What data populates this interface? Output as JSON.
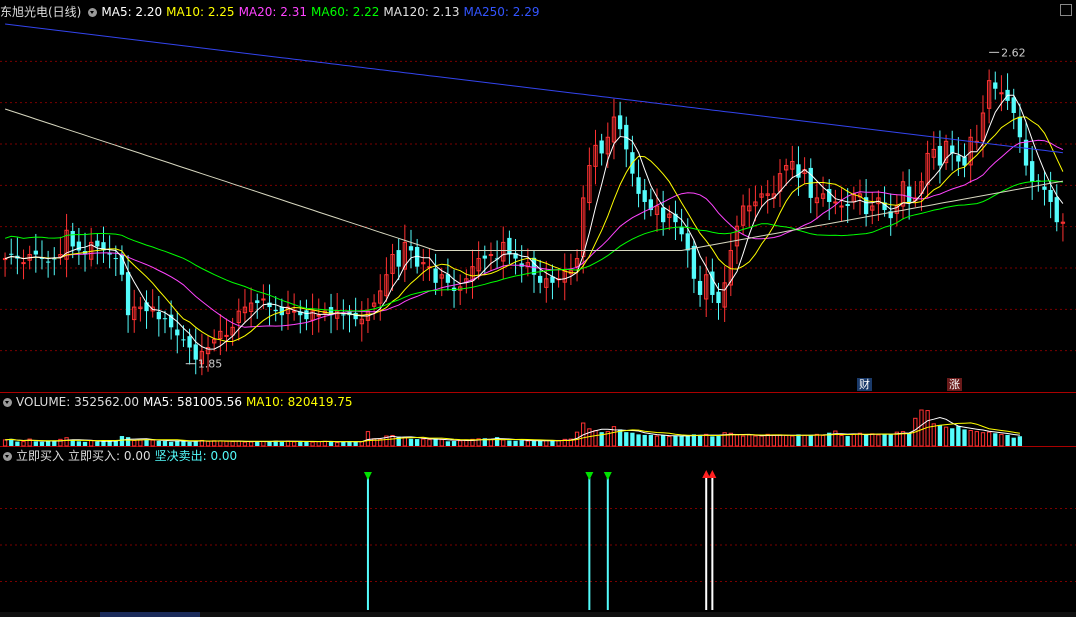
{
  "header": {
    "title": "东旭光电(日线)",
    "ma": [
      {
        "label": "MA5: 2.20",
        "color": "#ffffff"
      },
      {
        "label": "MA10: 2.25",
        "color": "#ffff00"
      },
      {
        "label": "MA20: 2.31",
        "color": "#ff44ff"
      },
      {
        "label": "MA60: 2.22",
        "color": "#00ff00"
      },
      {
        "label": "MA120: 2.13",
        "color": "#e0e0e0"
      },
      {
        "label": "MA250: 2.29",
        "color": "#3355ff"
      }
    ]
  },
  "volume_header": {
    "label": "VOLUME: 352562.00",
    "ma5": "MA5: 581005.56",
    "ma10": "MA10: 820419.75"
  },
  "signal_header": {
    "name": "立即买入",
    "buy": "立即买入: 0.00",
    "sell": "坚决卖出: 0.00"
  },
  "badges": {
    "cai": "财",
    "zhang": "涨"
  },
  "annotations": {
    "high": "2.62",
    "low": "1.85"
  },
  "colors": {
    "up": "#ff3232",
    "down": "#54fcfc",
    "grid": "#7a0000",
    "ma5": "#ffffff",
    "ma10": "#ffff00",
    "ma20": "#ff44ff",
    "ma60": "#00ff00",
    "ma120": "#d8d8c0",
    "ma250": "#3344ee"
  },
  "chart_data": {
    "type": "candlestick",
    "symbol": "东旭光电",
    "period": "日线",
    "price_range": [
      1.78,
      2.7
    ],
    "high_mark": 2.62,
    "low_mark": 1.85,
    "closes": [
      2.11,
      2.12,
      2.11,
      2.1,
      2.12,
      2.12,
      2.11,
      2.1,
      2.11,
      2.12,
      2.18,
      2.14,
      2.13,
      2.12,
      2.15,
      2.14,
      2.13,
      2.12,
      2.11,
      2.07,
      1.97,
      1.99,
      1.99,
      1.98,
      1.99,
      1.96,
      1.96,
      1.94,
      1.92,
      1.91,
      1.89,
      1.86,
      1.88,
      1.89,
      1.91,
      1.93,
      1.92,
      1.94,
      1.98,
      1.99,
      2.0,
      2.0,
      2.01,
      1.99,
      1.98,
      1.97,
      1.99,
      1.98,
      1.97,
      1.96,
      1.98,
      1.97,
      1.98,
      1.97,
      1.98,
      1.97,
      1.97,
      1.96,
      1.96,
      1.98,
      2.0,
      2.03,
      2.07,
      2.12,
      2.09,
      2.15,
      2.13,
      2.09,
      2.1,
      2.09,
      2.05,
      2.07,
      2.05,
      2.03,
      2.04,
      2.06,
      2.09,
      2.11,
      2.11,
      2.12,
      2.11,
      2.15,
      2.12,
      2.11,
      2.09,
      2.1,
      2.07,
      2.05,
      2.06,
      2.05,
      2.06,
      2.08,
      2.08,
      2.11,
      2.26,
      2.34,
      2.39,
      2.37,
      2.41,
      2.46,
      2.43,
      2.38,
      2.32,
      2.27,
      2.25,
      2.23,
      2.24,
      2.2,
      2.22,
      2.2,
      2.17,
      2.13,
      2.06,
      2.02,
      2.07,
      2.02,
      2.0,
      2.05,
      2.13,
      2.19,
      2.24,
      2.24,
      2.25,
      2.27,
      2.27,
      2.27,
      2.32,
      2.34,
      2.35,
      2.31,
      2.33,
      2.26,
      2.26,
      2.27,
      2.25,
      2.25,
      2.24,
      2.24,
      2.27,
      2.27,
      2.22,
      2.24,
      2.26,
      2.23,
      2.21,
      2.24,
      2.3,
      2.25,
      2.26,
      2.3,
      2.37,
      2.38,
      2.34,
      2.4,
      2.37,
      2.35,
      2.34,
      2.41,
      2.4,
      2.47,
      2.55,
      2.53,
      2.52,
      2.5,
      2.47,
      2.41,
      2.34,
      2.3,
      2.3,
      2.28,
      2.25,
      2.2,
      2.2
    ],
    "volume_axis_max": 1300000,
    "volumes": [
      220000,
      260000,
      160000,
      160000,
      250000,
      170000,
      150000,
      170000,
      180000,
      240000,
      300000,
      230000,
      170000,
      150000,
      200000,
      160000,
      180000,
      170000,
      200000,
      360000,
      320000,
      200000,
      210000,
      230000,
      210000,
      180000,
      180000,
      150000,
      200000,
      190000,
      150000,
      180000,
      200000,
      170000,
      190000,
      180000,
      170000,
      160000,
      180000,
      140000,
      150000,
      180000,
      160000,
      170000,
      190000,
      150000,
      180000,
      150000,
      170000,
      170000,
      140000,
      160000,
      170000,
      170000,
      120000,
      150000,
      180000,
      170000,
      160000,
      520000,
      260000,
      240000,
      360000,
      380000,
      340000,
      300000,
      260000,
      250000,
      250000,
      230000,
      260000,
      230000,
      170000,
      180000,
      190000,
      220000,
      240000,
      260000,
      280000,
      240000,
      320000,
      220000,
      200000,
      190000,
      210000,
      180000,
      190000,
      190000,
      200000,
      180000,
      200000,
      240000,
      250000,
      500000,
      830000,
      620000,
      560000,
      500000,
      520000,
      700000,
      600000,
      500000,
      480000,
      420000,
      400000,
      400000,
      360000,
      380000,
      340000,
      380000,
      360000,
      370000,
      420000,
      400000,
      420000,
      350000,
      380000,
      480000,
      460000,
      400000,
      360000,
      400000,
      360000,
      360000,
      420000,
      380000,
      400000,
      380000,
      360000,
      420000,
      380000,
      400000,
      420000,
      380000,
      480000,
      540000,
      380000,
      360000,
      420000,
      460000,
      420000,
      440000,
      400000,
      450000,
      420000,
      500000,
      520000,
      460000,
      1000000,
      1300000,
      1280000,
      800000,
      760000,
      680000,
      640000,
      720000,
      600000,
      560000,
      520000,
      480000,
      500000,
      460000,
      420000,
      400000,
      300000,
      352562
    ],
    "signals": [
      {
        "bar_index": 59,
        "type": "buy-green"
      },
      {
        "bar_index": 95,
        "type": "buy-green"
      },
      {
        "bar_index": 98,
        "type": "buy-green"
      },
      {
        "bar_index": 114,
        "type": "sell-red"
      },
      {
        "bar_index": 115,
        "type": "sell-red"
      }
    ]
  }
}
